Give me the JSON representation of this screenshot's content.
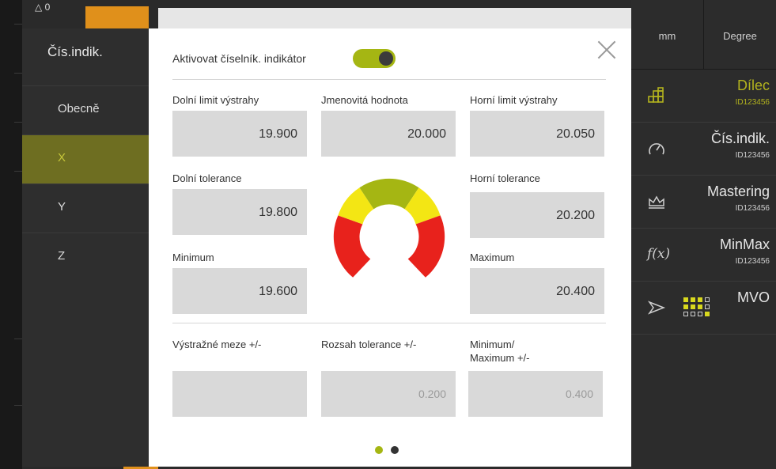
{
  "topbar": {
    "warning_text": "△ 0"
  },
  "left_menu": {
    "title": "Čís.indik.",
    "items": [
      {
        "label": "Obecně"
      },
      {
        "label": "X",
        "active": true
      },
      {
        "label": "Y"
      },
      {
        "label": "Z"
      }
    ]
  },
  "right_panel": {
    "units": [
      "mm",
      "Degree"
    ],
    "items": [
      {
        "icon": "part-icon",
        "name": "Dílec",
        "sub": "ID123456",
        "active": true
      },
      {
        "icon": "gauge-icon",
        "name": "Čís.indik.",
        "sub": "ID123456"
      },
      {
        "icon": "crown-icon",
        "name": "Mastering",
        "sub": "ID123456"
      },
      {
        "icon": "function-icon",
        "name": "MinMax",
        "sub": "ID123456"
      },
      {
        "icon": "send-icon",
        "name": "MVO",
        "sub": ""
      }
    ]
  },
  "dialog": {
    "activate_label": "Aktivovat číselník. indikátor",
    "toggle_on": true,
    "fields": {
      "lower_warning": {
        "label": "Dolní limit výstrahy",
        "value": "19.900"
      },
      "nominal": {
        "label": "Jmenovitá hodnota",
        "value": "20.000"
      },
      "upper_warning": {
        "label": "Horní limit výstrahy",
        "value": "20.050"
      },
      "lower_tolerance": {
        "label": "Dolní tolerance",
        "value": "19.800"
      },
      "upper_tolerance": {
        "label": "Horní tolerance",
        "value": "20.200"
      },
      "minimum": {
        "label": "Minimum",
        "value": "19.600"
      },
      "maximum": {
        "label": "Maximum",
        "value": "20.400"
      },
      "warning_limits": {
        "label": "Výstražné meze +/-",
        "value": ""
      },
      "tolerance_range": {
        "label": "Rozsah tolerance +/-",
        "value": "0.200"
      },
      "min_max": {
        "label_line1": "Minimum/",
        "label_line2": "Maximum +/-",
        "value": "0.400"
      }
    },
    "page_indicator": {
      "current": 1,
      "total": 2
    }
  },
  "colors": {
    "accent": "#a5b613",
    "gauge_red": "#e8221c",
    "gauge_yellow": "#f3e614",
    "gauge_olive": "#a5b613",
    "page_dot_active": "#a5b613",
    "page_dot_inactive": "#333333"
  }
}
